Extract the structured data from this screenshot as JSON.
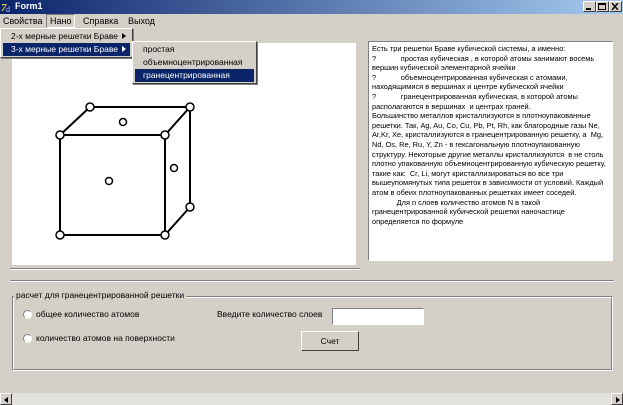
{
  "window": {
    "title": "Form1",
    "controls": [
      "minimize-icon",
      "maximize-icon",
      "close-icon"
    ]
  },
  "menubar": {
    "items": [
      "Свойства",
      "Нано",
      "Справка",
      "Выход"
    ],
    "active_index": 1
  },
  "submenu": {
    "items": [
      "2-х мерные решетки Браве",
      "3-х мерные решетки Браве"
    ],
    "highlighted_index": 1
  },
  "submenu2": {
    "items": [
      "простая",
      "объемноцентрированная",
      "гранецентрированная"
    ],
    "highlighted_index": 2
  },
  "memo": {
    "paragraphs": [
      "Есть три решетки Браве кубической системы, а именно:\n?            простая кубическая , в которой атомы занимают восемь вершин кубической элементарной ячейки\n?            объемноцентрированная кубическая с атомами, находящимися в вершинах и центре кубической ячейки\n?            гранецентрированная кубическая, в которой атомы располагаются в вершинах  и центрах граней.",
      "Большинство металлов кристаллизуются в плотноупакованные решетки. Так, Ag, Au, Co, Cu, Pb, Pt, Rh, как благородные газы Ne, Ar,Kr, Xe, кристаллизуются в гранецентрированную решетку, а  Mg, Nd, Os, Re, Ru, Y, Zn - в гексагональную плотноупакованную структуру. Некоторые другие металлы кристаллизуются  в не столь плотно упакованную объемноцентрированную кубическую решетку, такие как:  Cr, Li, могут кристаллизироваться во все три вышеупомянутых типа решеток в зависимости от условий. Каждый атом в обеих плотноупакованных решетках имеет соседей.",
      "            Для n слоев количество атомов N в такой гранецентрированной кубической решетки наночастице определяется по формуле"
    ]
  },
  "group": {
    "caption": "расчет для гранецентрированной решетки",
    "radio1": "общее количество атомов",
    "radio2": "количество атомов на поверхности",
    "input_label": "Введите количество слоев",
    "input_value": "",
    "button": "Счет"
  },
  "colors": {
    "titlebar_start": "#0a246a",
    "titlebar_end": "#a6caf0",
    "face": "#d4d0c8",
    "highlight": "#0a246a"
  }
}
